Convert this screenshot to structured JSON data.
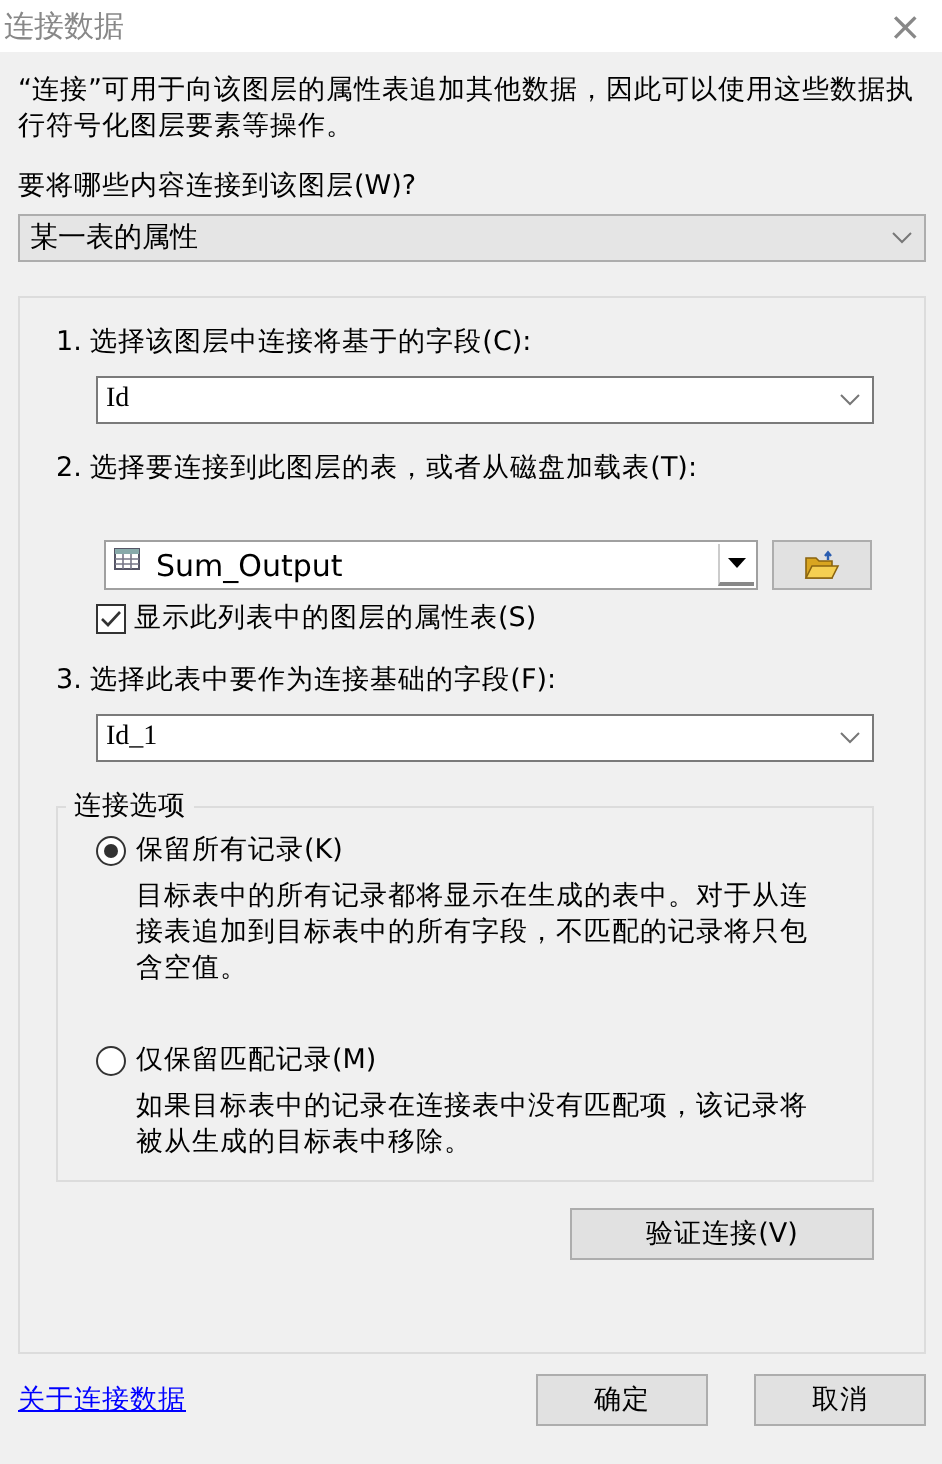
{
  "window": {
    "title": "连接数据",
    "close": "×"
  },
  "intro": "“连接”可用于向该图层的属性表追加其他数据，因此可以使用这些数据执行符号化图层要素等操作。",
  "join_what": {
    "label": "要将哪些内容连接到该图层(W)?",
    "value": "某一表的属性"
  },
  "steps": [
    {
      "kind": "field",
      "label": "1. 选择该图层中连接将基于的字段(C):",
      "value": "Id"
    },
    {
      "kind": "table",
      "label": "2. 选择要连接到此图层的表，或者从磁盘加载表(T):",
      "value": "Sum_Output",
      "option": {
        "label": "显示此列表中的图层的属性表(S)",
        "checked": true
      }
    },
    {
      "kind": "field",
      "label": "3. 选择此表中要作为连接基础的字段(F):",
      "value": "Id_1"
    }
  ],
  "join_options": {
    "title": "连接选项",
    "options": [
      {
        "label": "保留所有记录(K)",
        "selected": true,
        "description": "目标表中的所有记录都将显示在生成的表中。对于从连接表追加到目标表中的所有字段，不匹配的记录将只包含空值。"
      },
      {
        "label": "仅保留匹配记录(M)",
        "selected": false,
        "description": "如果目标表中的记录在连接表中没有匹配项，该记录将被从生成的目标表中移除。"
      }
    ]
  },
  "validate_button": "验证连接(V)",
  "help_link": "关于连接数据",
  "buttons": [
    "确定",
    "取消"
  ]
}
